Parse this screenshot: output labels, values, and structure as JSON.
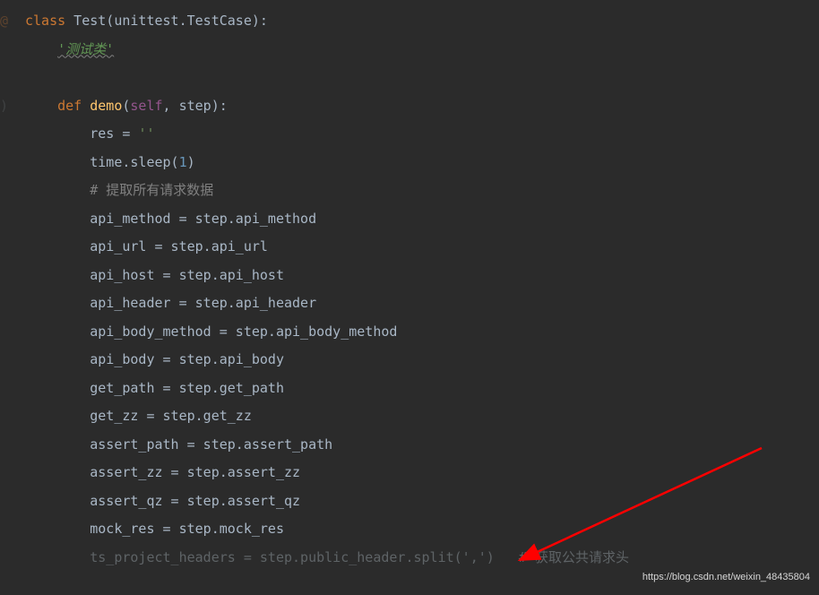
{
  "code": {
    "line1": {
      "kw_class": "class",
      "name": " Test(unittest.TestCase):"
    },
    "line2": {
      "indent": "    ",
      "docstring": "'测试类'"
    },
    "line4": {
      "indent": "    ",
      "kw_def": "def",
      "space": " ",
      "fname": "demo",
      "lparen": "(",
      "self": "self",
      "rest": ", step):"
    },
    "line5": {
      "indent": "        ",
      "var": "res = ",
      "str": "''"
    },
    "line6": {
      "indent": "        ",
      "text": "time.sleep(",
      "num": "1",
      "rparen": ")"
    },
    "line7": {
      "indent": "        ",
      "comment": "# 提取所有请求数据"
    },
    "line8": {
      "indent": "        ",
      "text": "api_method = step.api_method"
    },
    "line9": {
      "indent": "        ",
      "text": "api_url = step.api_url"
    },
    "line10": {
      "indent": "        ",
      "text": "api_host = step.api_host"
    },
    "line11": {
      "indent": "        ",
      "text": "api_header = step.api_header"
    },
    "line12": {
      "indent": "        ",
      "text": "api_body_method = step.api_body_method"
    },
    "line13": {
      "indent": "        ",
      "text": "api_body = step.api_body"
    },
    "line14": {
      "indent": "        ",
      "text": "get_path = step.get_path"
    },
    "line15": {
      "indent": "        ",
      "text": "get_zz = step.get_zz"
    },
    "line16": {
      "indent": "        ",
      "text": "assert_path = step.assert_path"
    },
    "line17": {
      "indent": "        ",
      "text": "assert_zz = step.assert_zz"
    },
    "line18": {
      "indent": "        ",
      "text": "assert_qz = step.assert_qz"
    },
    "line19": {
      "indent": "        ",
      "text": "mock_res = step.mock_res"
    },
    "line20": {
      "indent": "        ",
      "text": "ts_project_headers = step.public_header.split(",
      "str": "','",
      "rparen": ")",
      "tail_comment": "   # 获取公共请求头"
    }
  },
  "watermark": "https://blog.csdn.net/weixin_48435804"
}
